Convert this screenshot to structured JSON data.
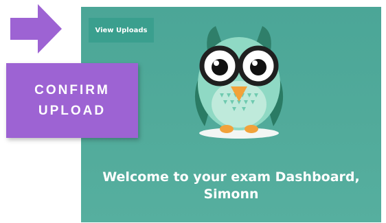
{
  "arrow": {
    "icon": "arrow-right-icon",
    "color": "#9d63d3"
  },
  "confirm": {
    "line1": "CONFIRM",
    "line2": "UPLOAD",
    "color": "#9d63d3"
  },
  "dashboard": {
    "view_uploads_label": "View Uploads",
    "welcome_line1": "Welcome to your exam Dashboard,",
    "welcome_line2": "Simonn",
    "background_color": "#4ba697",
    "mascot": "owl-mascot-icon"
  }
}
